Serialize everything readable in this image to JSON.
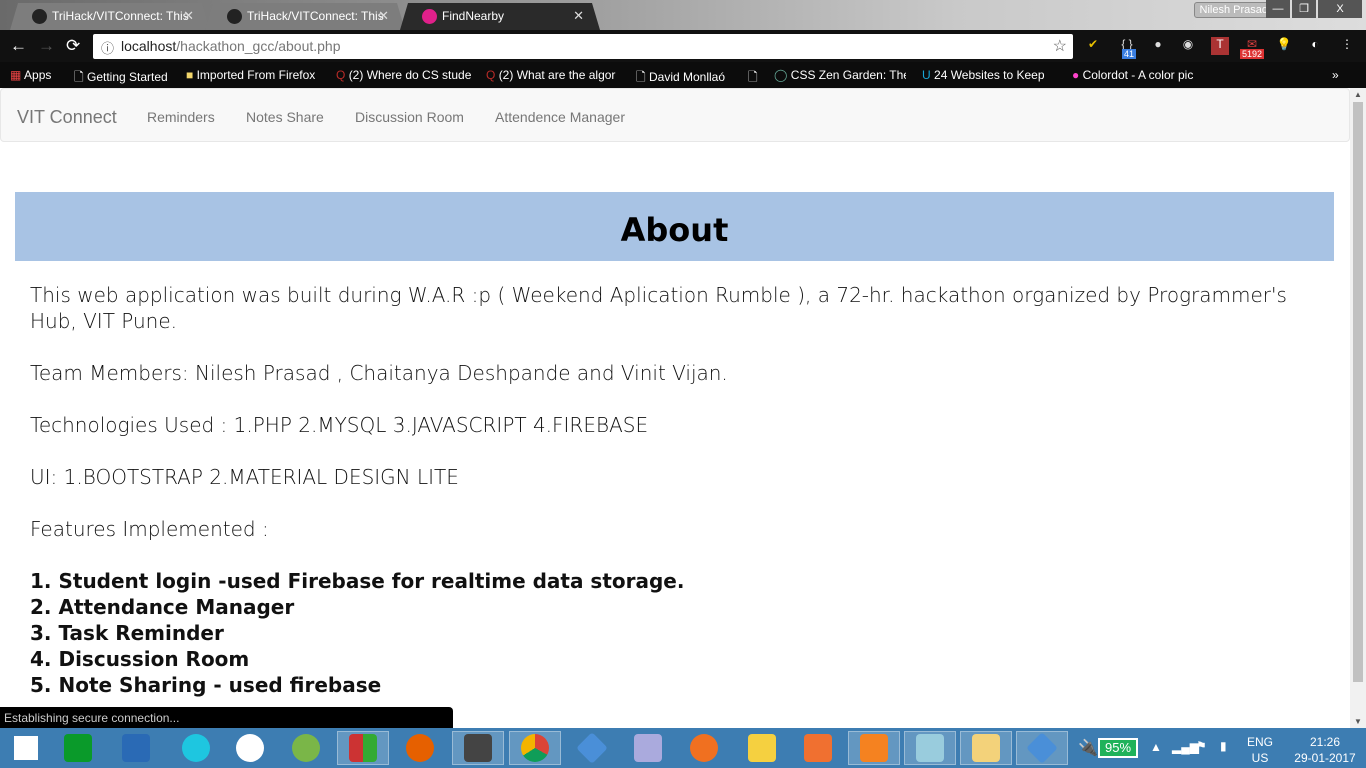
{
  "browser": {
    "tabs": [
      {
        "title": "TriHack/VITConnect: This",
        "icon": "github-icon"
      },
      {
        "title": "TriHack/VITConnect: This",
        "icon": "github-icon"
      },
      {
        "title": "FindNearby",
        "icon": "app-icon",
        "active": true
      }
    ],
    "user": "Nilesh Prasad",
    "url_host": "localhost",
    "url_path": "/hackathon_gcc/about.php",
    "extensions": [
      {
        "name": "norton-icon"
      },
      {
        "name": "brackets-icon",
        "badge": "41"
      },
      {
        "name": "ninja-icon"
      },
      {
        "name": "circle-icon"
      },
      {
        "name": "t-icon"
      },
      {
        "name": "gmail-icon",
        "badge": "5192"
      },
      {
        "name": "bulb-icon"
      },
      {
        "name": "dark-circle-icon"
      }
    ],
    "bookmarks": [
      "Apps",
      "Getting Started",
      "Imported From Firefox",
      "(2) Where do CS stude",
      "(2) What are the algor",
      "David Monllaó",
      "CSS Zen Garden: The",
      "24 Websites to Keep",
      "Colordot - A color pic"
    ],
    "status": "Establishing secure connection..."
  },
  "navbar": {
    "brand": "VIT Connect",
    "links": [
      "Reminders",
      "Notes Share",
      "Discussion Room",
      "Attendence Manager"
    ]
  },
  "page": {
    "title": "About",
    "intro": "This web application was built during W.A.R :p ( Weekend Aplication Rumble ), a 72-hr. hackathon organized by Programmer's Hub, VIT Pune.",
    "team": "Team Members: Nilesh Prasad , Chaitanya Deshpande and Vinit Vijan.",
    "tech": "Technologies Used : 1.PHP 2.MYSQL 3.JAVASCRIPT 4.FIREBASE",
    "ui": "UI: 1.BOOTSTRAP 2.MATERIAL DESIGN LITE",
    "features_heading": "Features Implemented :",
    "features": [
      "1. Student login -used Firebase for realtime data storage.",
      "2. Attendance Manager",
      "3. Task Reminder",
      "4. Discussion Room",
      "5. Note Sharing - used firebase"
    ]
  },
  "taskbar": {
    "apps": [
      "windows-start-icon",
      "store-icon",
      "powershell-icon",
      "shareit-icon",
      "github-desktop-icon",
      "android-studio-icon",
      "windows-icon",
      "firefox-icon",
      "sublime-icon",
      "chrome-icon",
      "git-icon",
      "virtualbox-icon",
      "media-player-icon",
      "sticky-pin-icon",
      "screenshot-icon",
      "foxit-pdf-icon",
      "notepad-icon",
      "explorer-icon",
      "git-icon"
    ],
    "battery": "95%",
    "lang1": "ENG",
    "lang2": "US",
    "time": "21:26",
    "date": "29-01-2017"
  }
}
